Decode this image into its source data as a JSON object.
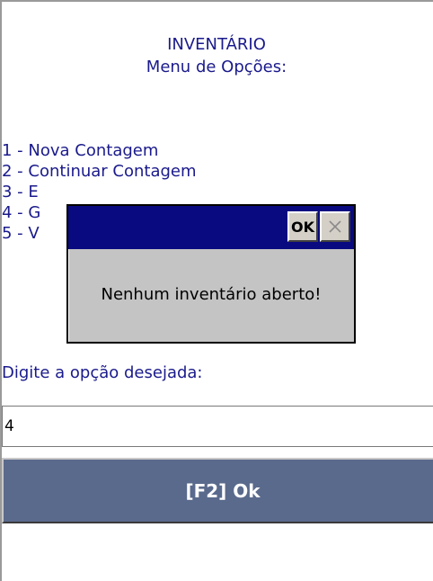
{
  "header": {
    "title": "INVENTÁRIO",
    "subtitle": "Menu de Opções:"
  },
  "menu": {
    "options": [
      "1 - Nova Contagem",
      "2 - Continuar Contagem",
      "3 - E",
      "4 - G",
      "5 - V"
    ]
  },
  "prompt": "Digite a opção desejada:",
  "input": {
    "value": "4"
  },
  "ok_button": {
    "label": "[F2] Ok"
  },
  "dialog": {
    "ok_label": "OK",
    "message": "Nenhum inventário aberto!"
  },
  "colors": {
    "text": "#1a1a8c",
    "dialog_titlebar": "#0a0a80",
    "button_bg": "#5a6a8c"
  }
}
